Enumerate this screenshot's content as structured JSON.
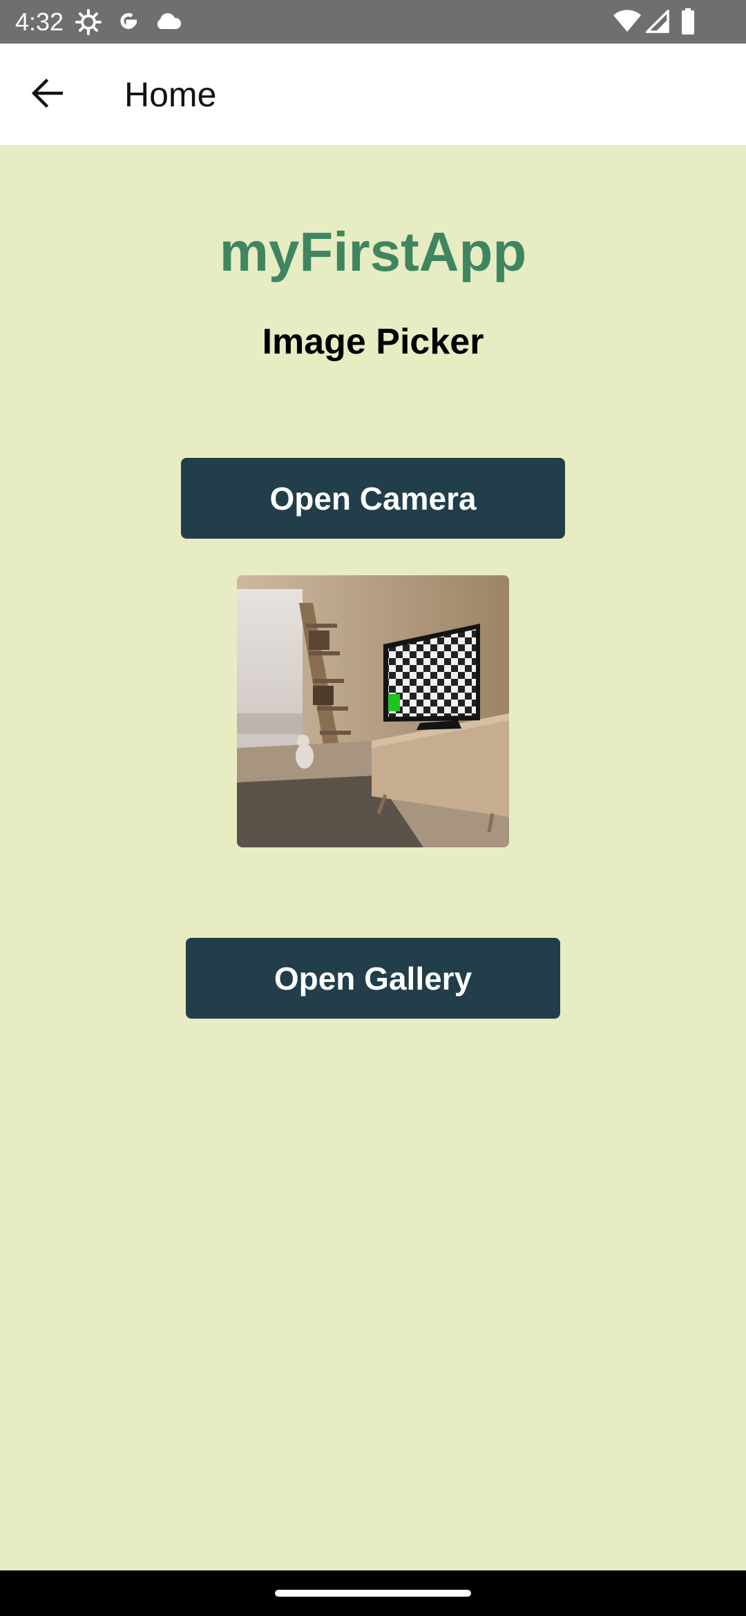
{
  "status_bar": {
    "time": "4:32",
    "icons": [
      "settings-gear-icon",
      "google-g-icon",
      "cloud-icon",
      "wifi-icon",
      "cell-signal-icon",
      "battery-icon"
    ]
  },
  "app_bar": {
    "back_icon": "arrow-back-icon",
    "title": "Home"
  },
  "main": {
    "app_name": "myFirstApp",
    "section_title": "Image Picker",
    "open_camera_label": "Open Camera",
    "open_gallery_label": "Open Gallery",
    "preview_image": "picked-image-room-with-tv"
  },
  "colors": {
    "background": "#e7ecc2",
    "brand_green": "#3f8660",
    "button_bg": "#213e4a",
    "button_text": "#ffffff",
    "status_bar": "#6f6f6f"
  }
}
